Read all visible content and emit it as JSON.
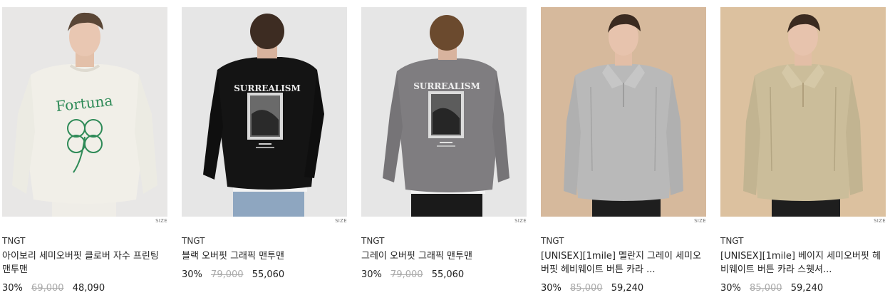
{
  "size_label": "SIZE",
  "products": [
    {
      "brand": "TNGT",
      "title": "아이보리 세미오버핏 클로버 자수 프린팅 맨투맨",
      "discount": "30%",
      "original_price": "69,000",
      "sale_price": "48,090",
      "background": "#e8e7e6",
      "garment_color": "#f1efe8",
      "print": "Fortuna",
      "view": "front"
    },
    {
      "brand": "TNGT",
      "title": "블랙 오버핏 그래픽 맨투맨",
      "discount": "30%",
      "original_price": "79,000",
      "sale_price": "55,060",
      "background": "#e6e6e6",
      "garment_color": "#141414",
      "print": "SURREALISM",
      "view": "back"
    },
    {
      "brand": "TNGT",
      "title": "그레이 오버핏 그래픽 맨투맨",
      "discount": "30%",
      "original_price": "79,000",
      "sale_price": "55,060",
      "background": "#e6e6e6",
      "garment_color": "#7f7d80",
      "print": "SURREALISM",
      "view": "back"
    },
    {
      "brand": "TNGT",
      "title": "[UNISEX][1mile] 멜란지 그레이 세미오버핏 헤비웨이트 버튼 카라 ...",
      "discount": "30%",
      "original_price": "85,000",
      "sale_price": "59,240",
      "background": "#d6b99c",
      "garment_color": "#b9b9b9",
      "print": "",
      "view": "collar"
    },
    {
      "brand": "TNGT",
      "title": "[UNISEX][1mile] 베이지 세미오버핏 헤비웨이트 버튼 카라 스웻셔...",
      "discount": "30%",
      "original_price": "85,000",
      "sale_price": "59,240",
      "background": "#dcc19f",
      "garment_color": "#cbbd9a",
      "print": "",
      "view": "collar"
    }
  ]
}
